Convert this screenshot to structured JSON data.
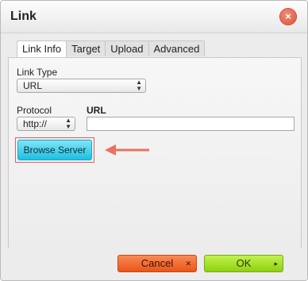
{
  "dialog": {
    "title": "Link",
    "close_glyph": "×",
    "tabs": [
      {
        "label": "Link Info",
        "active": true
      },
      {
        "label": "Target",
        "active": false
      },
      {
        "label": "Upload",
        "active": false
      },
      {
        "label": "Advanced",
        "active": false
      }
    ]
  },
  "link_info": {
    "link_type_label": "Link Type",
    "link_type_value": "URL",
    "protocol_label": "Protocol",
    "protocol_value": "http://",
    "url_label": "URL",
    "url_value": "",
    "browse_label": "Browse Server"
  },
  "footer": {
    "cancel_label": "Cancel",
    "cancel_mark": "✕",
    "ok_label": "OK",
    "ok_mark": "▸"
  },
  "colors": {
    "cancel": "#f26b2c",
    "ok": "#a7e12c",
    "browse": "#3fd0ec",
    "highlight_arrow": "#e8735f"
  }
}
